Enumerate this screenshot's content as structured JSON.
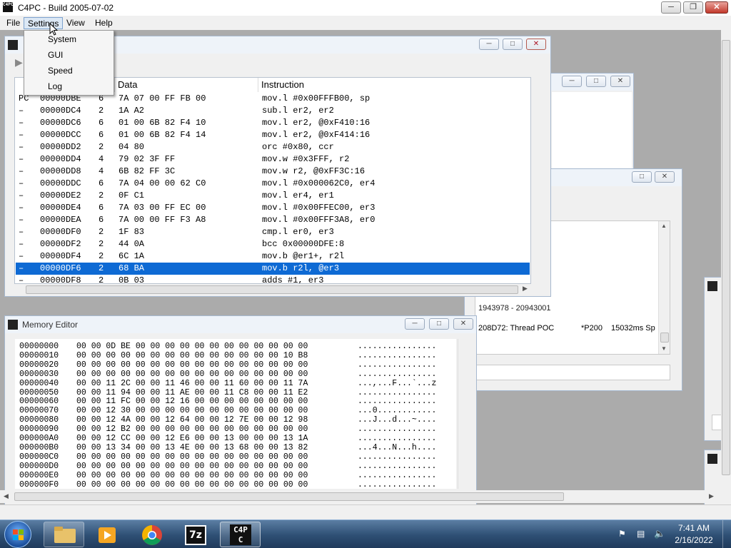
{
  "window": {
    "title": "C4PC - Build 2005-07-02",
    "app_icon": "C4PC"
  },
  "menu": {
    "file": "File",
    "settings": "Settings",
    "view": "View",
    "help": "Help"
  },
  "settings_menu": [
    "System",
    "GUI",
    "Speed",
    "Log"
  ],
  "disassembly": {
    "columns": {
      "data": "Data",
      "instruction": "Instruction"
    },
    "rows": [
      {
        "m": "PC",
        "addr": "00000DBE",
        "len": "6",
        "data": "7A 07 00 FF FB 00",
        "ins": "mov.l #0x00FFFB00, sp"
      },
      {
        "m": "–",
        "addr": "00000DC4",
        "len": "2",
        "data": "1A A2",
        "ins": "sub.l er2, er2"
      },
      {
        "m": "–",
        "addr": "00000DC6",
        "len": "6",
        "data": "01 00 6B 82 F4 10",
        "ins": "mov.l er2, @0xF410:16"
      },
      {
        "m": "–",
        "addr": "00000DCC",
        "len": "6",
        "data": "01 00 6B 82 F4 14",
        "ins": "mov.l er2, @0xF414:16"
      },
      {
        "m": "–",
        "addr": "00000DD2",
        "len": "2",
        "data": "04 80",
        "ins": "orc #0x80, ccr"
      },
      {
        "m": "–",
        "addr": "00000DD4",
        "len": "4",
        "data": "79 02 3F FF",
        "ins": "mov.w #0x3FFF, r2"
      },
      {
        "m": "–",
        "addr": "00000DD8",
        "len": "4",
        "data": "6B 82 FF 3C",
        "ins": "mov.w r2, @0xFF3C:16"
      },
      {
        "m": "–",
        "addr": "00000DDC",
        "len": "6",
        "data": "7A 04 00 00 62 C0",
        "ins": "mov.l #0x000062C0, er4"
      },
      {
        "m": "–",
        "addr": "00000DE2",
        "len": "2",
        "data": "0F C1",
        "ins": "mov.l er4, er1"
      },
      {
        "m": "–",
        "addr": "00000DE4",
        "len": "6",
        "data": "7A 03 00 FF EC 00",
        "ins": "mov.l #0x00FFEC00, er3"
      },
      {
        "m": "–",
        "addr": "00000DEA",
        "len": "6",
        "data": "7A 00 00 FF F3 A8",
        "ins": "mov.l #0x00FFF3A8, er0"
      },
      {
        "m": "–",
        "addr": "00000DF0",
        "len": "2",
        "data": "1F 83",
        "ins": "cmp.l er0, er3"
      },
      {
        "m": "–",
        "addr": "00000DF2",
        "len": "2",
        "data": "44 0A",
        "ins": "bcc 0x00000DFE:8"
      },
      {
        "m": "–",
        "addr": "00000DF4",
        "len": "2",
        "data": "6C 1A",
        "ins": "mov.b @er1+, r2l"
      },
      {
        "m": "–",
        "addr": "00000DF6",
        "len": "2",
        "data": "68 BA",
        "ins": "mov.b r2l, @er3"
      },
      {
        "m": "–",
        "addr": "00000DF8",
        "len": "2",
        "data": "0B 03",
        "ins": "adds #1, er3"
      }
    ]
  },
  "memory_editor": {
    "title": "Memory Editor",
    "rows": [
      {
        "addr": "00000000",
        "hex": "00 00 0D BE 00 00 00 00 00 00 00 00 00 00 00 00",
        "ascii": "................"
      },
      {
        "addr": "00000010",
        "hex": "00 00 00 00 00 00 00 00 00 00 00 00 00 00 10 B8",
        "ascii": "................"
      },
      {
        "addr": "00000020",
        "hex": "00 00 00 00 00 00 00 00 00 00 00 00 00 00 00 00",
        "ascii": "................"
      },
      {
        "addr": "00000030",
        "hex": "00 00 00 00 00 00 00 00 00 00 00 00 00 00 00 00",
        "ascii": "................"
      },
      {
        "addr": "00000040",
        "hex": "00 00 11 2C 00 00 11 46 00 00 11 60 00 00 11 7A",
        "ascii": "...,...F...`...z"
      },
      {
        "addr": "00000050",
        "hex": "00 00 11 94 00 00 11 AE 00 00 11 C8 00 00 11 E2",
        "ascii": "................"
      },
      {
        "addr": "00000060",
        "hex": "00 00 11 FC 00 00 12 16 00 00 00 00 00 00 00 00",
        "ascii": "................"
      },
      {
        "addr": "00000070",
        "hex": "00 00 12 30 00 00 00 00 00 00 00 00 00 00 00 00",
        "ascii": "...0............"
      },
      {
        "addr": "00000080",
        "hex": "00 00 12 4A 00 00 12 64 00 00 12 7E 00 00 12 98",
        "ascii": "...J...d...~...."
      },
      {
        "addr": "00000090",
        "hex": "00 00 12 B2 00 00 00 00 00 00 00 00 00 00 00 00",
        "ascii": "................"
      },
      {
        "addr": "000000A0",
        "hex": "00 00 12 CC 00 00 12 E6 00 00 13 00 00 00 13 1A",
        "ascii": "................"
      },
      {
        "addr": "000000B0",
        "hex": "00 00 13 34 00 00 13 4E 00 00 13 68 00 00 13 82",
        "ascii": "...4...N...h...."
      },
      {
        "addr": "000000C0",
        "hex": "00 00 00 00 00 00 00 00 00 00 00 00 00 00 00 00",
        "ascii": "................"
      },
      {
        "addr": "000000D0",
        "hex": "00 00 00 00 00 00 00 00 00 00 00 00 00 00 00 00",
        "ascii": "................"
      },
      {
        "addr": "000000E0",
        "hex": "00 00 00 00 00 00 00 00 00 00 00 00 00 00 00 00",
        "ascii": "................"
      },
      {
        "addr": "000000F0",
        "hex": "00 00 00 00 00 00 00 00 00 00 00 00 00 00 00 00",
        "ascii": "................"
      }
    ]
  },
  "thread_log": {
    "line1": "1943978 - 20943001",
    "line2_id": "208D72: Thread POC",
    "line2_pri": "*P200",
    "line2_time": "15032ms Sp"
  },
  "taskbar": {
    "time": "7:41 AM",
    "date": "2/16/2022",
    "c4pc_label": "C4PC",
    "sevenzip_label": "7z"
  },
  "colors": {
    "selection": "#0e6ad4",
    "taskbar": "#2e4f74",
    "desktop": "#ababab"
  }
}
